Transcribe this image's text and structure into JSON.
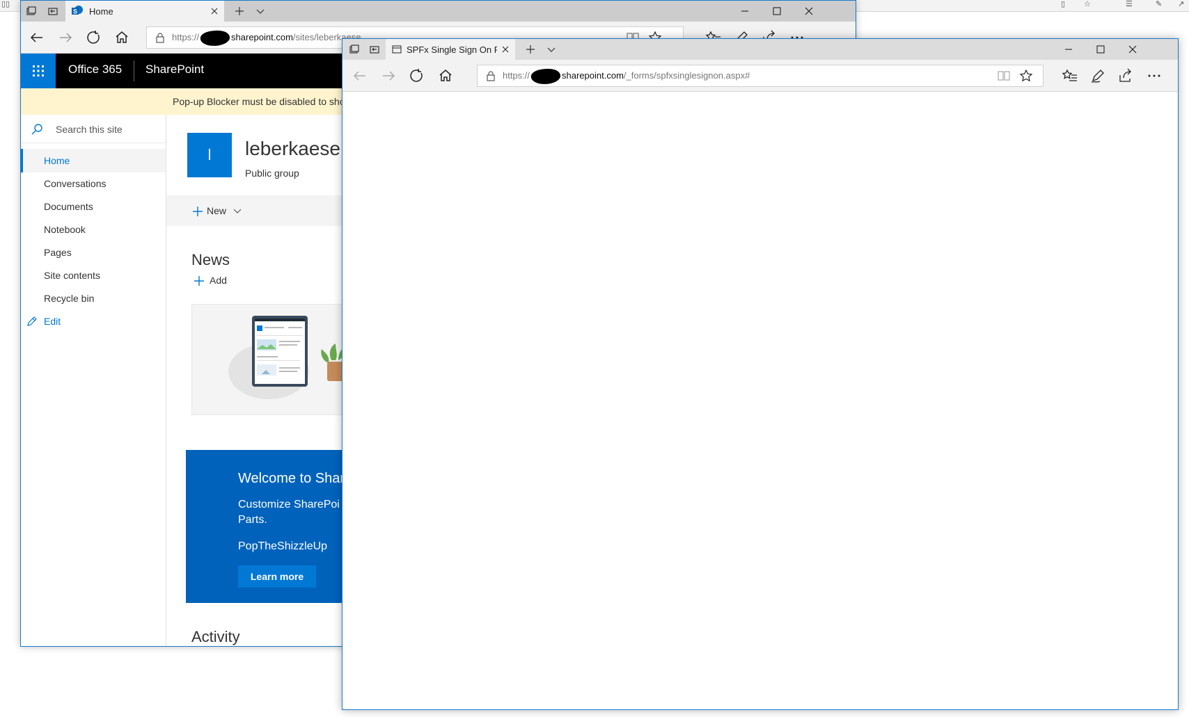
{
  "back_window": {
    "tab_title": "Home",
    "url_prefix": "https://",
    "url_domain": "sharepoint.com",
    "url_path": "/sites/leberkaese",
    "suite": {
      "office": "Office 365",
      "app": "SharePoint"
    },
    "popup_warning": "Pop-up Blocker must be disabled to sho",
    "search_placeholder": "Search this site",
    "nav": [
      {
        "label": "Home"
      },
      {
        "label": "Conversations"
      },
      {
        "label": "Documents"
      },
      {
        "label": "Notebook"
      },
      {
        "label": "Pages"
      },
      {
        "label": "Site contents"
      },
      {
        "label": "Recycle bin"
      }
    ],
    "edit_label": "Edit",
    "site": {
      "logo_letter": "l",
      "title": "leberkaese",
      "subtitle": "Public group"
    },
    "new_label": "New",
    "news_heading": "News",
    "add_label": "Add",
    "welcome": {
      "title": "Welcome to Shar",
      "line1": "Customize SharePoi",
      "line2": "Parts.",
      "line3": "PopTheShizzleUp",
      "button": "Learn more"
    },
    "activity_heading": "Activity"
  },
  "front_window": {
    "tab_title": "SPFx Single Sign On Rec",
    "url_prefix": "https://",
    "url_domain": "sharepoint.com",
    "url_path": "/_forms/spfxsinglesignon.aspx#"
  },
  "colors": {
    "accent": "#0078d4",
    "suite_bar": "#000000",
    "warning_bg": "#fff4ce",
    "welcome_bg": "#0062bb"
  }
}
